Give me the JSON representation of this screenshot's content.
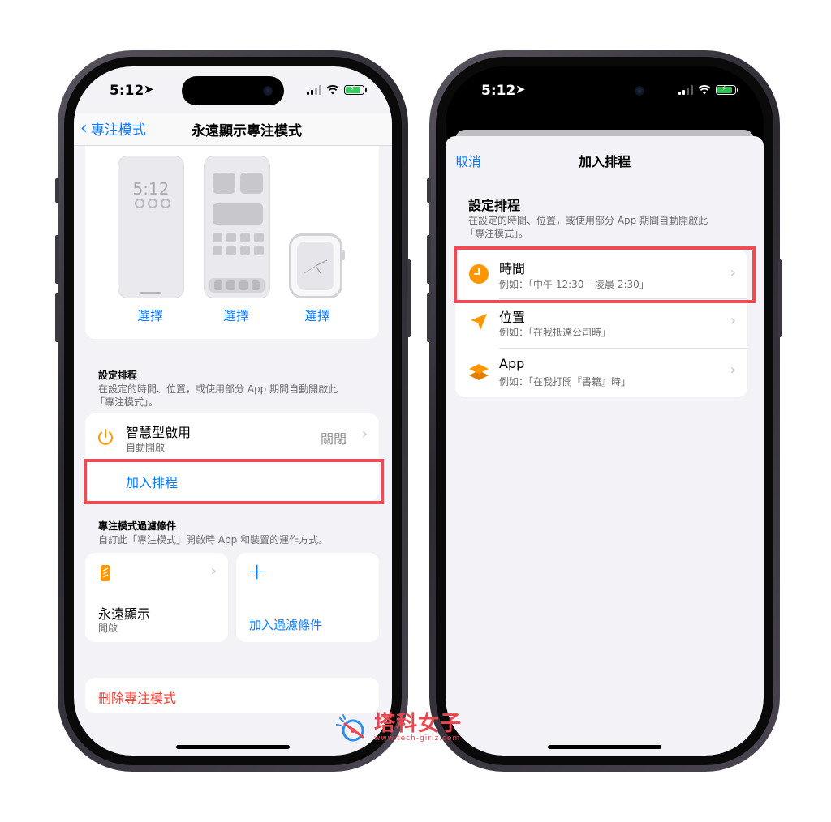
{
  "left_phone": {
    "status_time": "5:12",
    "nav": {
      "back_label": "專注模式",
      "title": "永遠顯示專注模式"
    },
    "lock_preview_time": "5:12",
    "choose_labels": [
      "選擇",
      "選擇",
      "選擇"
    ],
    "schedule": {
      "header": "設定排程",
      "desc_line1": "在設定的時間、位置，或使用部分 App 期間自動開啟此",
      "desc_line2": "「專注模式」。",
      "smart": {
        "title": "智慧型啟用",
        "subtitle": "自動開啟",
        "value": "關閉"
      },
      "add_label": "加入排程"
    },
    "filters": {
      "header": "專注模式過濾條件",
      "desc": "自訂此「專注模式」開啟時 App 和裝置的運作方式。",
      "always_on": {
        "title": "永遠顯示",
        "subtitle": "開啟"
      },
      "add_filter_label": "加入過濾條件"
    },
    "delete_label": "刪除專注模式"
  },
  "right_phone": {
    "status_time": "5:12",
    "sheet": {
      "cancel_label": "取消",
      "title": "加入排程"
    },
    "section": {
      "header": "設定排程",
      "desc_line1": "在設定的時間、位置，或使用部分 App 期間自動開啟此",
      "desc_line2": "「專注模式」。"
    },
    "options": [
      {
        "title": "時間",
        "subtitle": "例如：「中午 12:30 – 凌晨 2:30」",
        "icon": "clock-icon"
      },
      {
        "title": "位置",
        "subtitle": "例如：「在我抵達公司時」",
        "icon": "location-arrow-icon"
      },
      {
        "title": "App",
        "subtitle": "例如：「在我打開『書籍』時」",
        "icon": "layers-icon"
      }
    ]
  },
  "watermark": {
    "name": "塔科女子",
    "url": "www.tech-girlz.com"
  },
  "colors": {
    "ios_blue": "#0a7aff",
    "highlight_red": "#f04b54",
    "orange": "#ff9500",
    "destructive": "#ff3b30"
  }
}
